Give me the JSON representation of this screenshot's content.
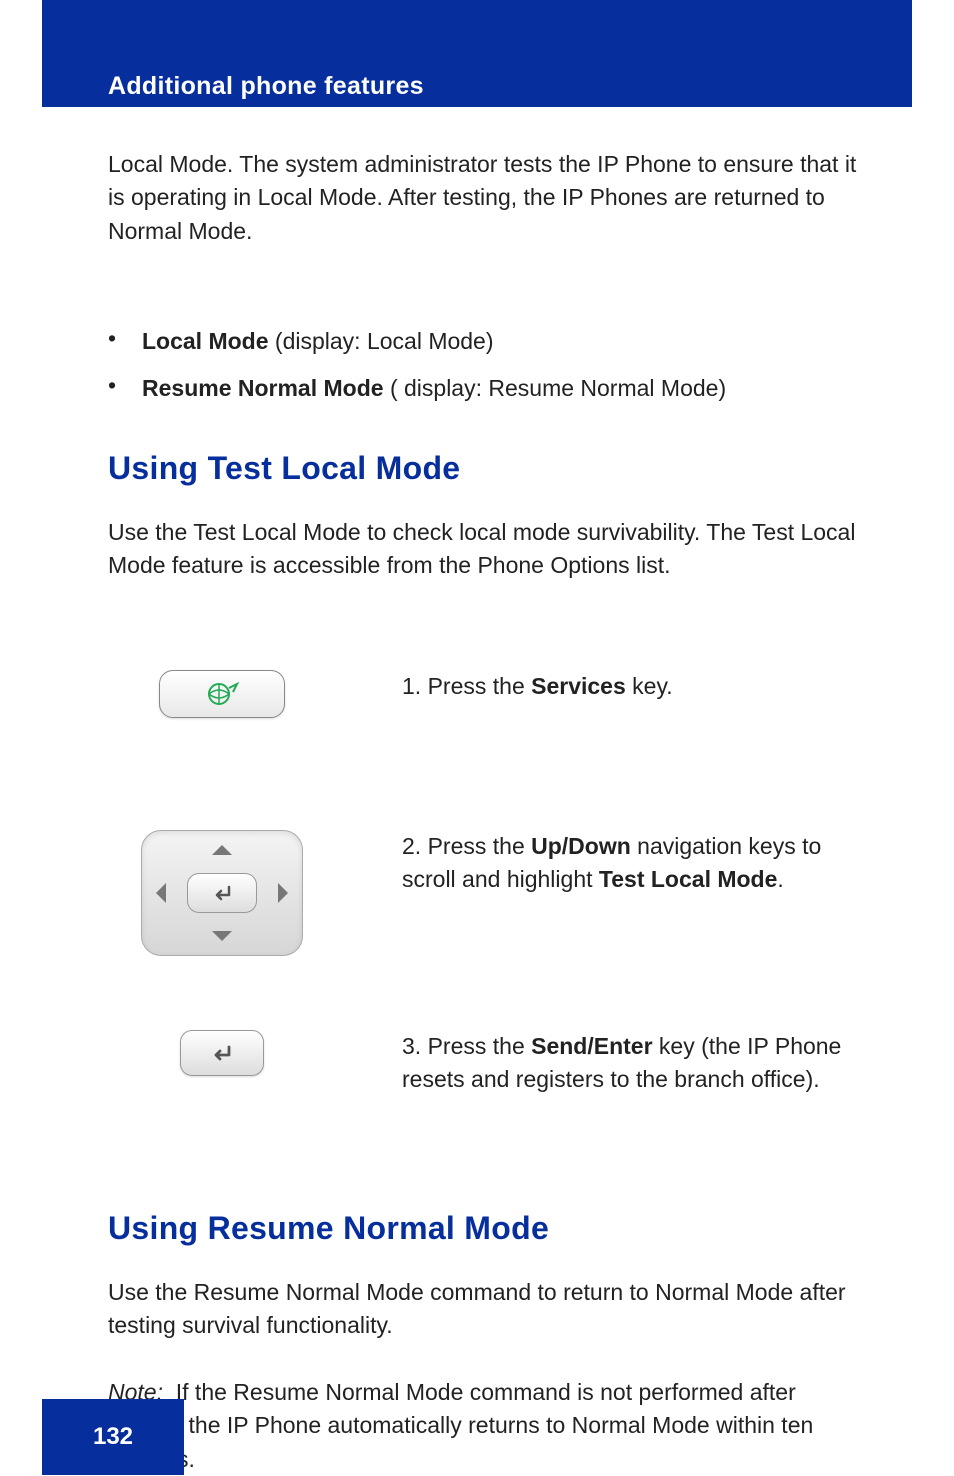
{
  "header": {
    "title": "Additional phone features"
  },
  "intro_para": "Local Mode. The system administrator tests the IP Phone to ensure that it is operating in Local Mode. After testing, the IP Phones are returned to Normal Mode.",
  "bullets": [
    {
      "term": "Local Mode",
      "rest": " (display: Local Mode)"
    },
    {
      "term": "Resume Normal Mode",
      "rest": " ( display: Resume Normal Mode)"
    }
  ],
  "section1": {
    "heading": "Using Test Local Mode",
    "intro": "Use the Test Local Mode to check local mode survivability. The Test Local Mode feature is accessible from the Phone Options list.",
    "step1": {
      "num": "1.",
      "text": "Press the ",
      "bold": "Services",
      "after": " key."
    },
    "step2": {
      "num": "2.",
      "text": "Press the ",
      "bold1": "Up/Down",
      "mid": " navigation keys to scroll and highlight ",
      "bold2": "Test Local Mode",
      "after": "."
    },
    "step3": {
      "num": "3.",
      "text": "Press the ",
      "bold": "Send/Enter",
      "after": " key (the IP Phone resets and registers to the branch office)."
    }
  },
  "section2": {
    "heading": "Using Resume Normal Mode",
    "intro": "Use the Resume Normal Mode command to return to Normal Mode after testing survival functionality.",
    "note_label": "Note:",
    "note_text": "If the Resume Normal Mode command is not performed after testing, the IP Phone automatically returns to Normal Mode within ten minutes."
  },
  "footer": {
    "page_number": "132"
  }
}
